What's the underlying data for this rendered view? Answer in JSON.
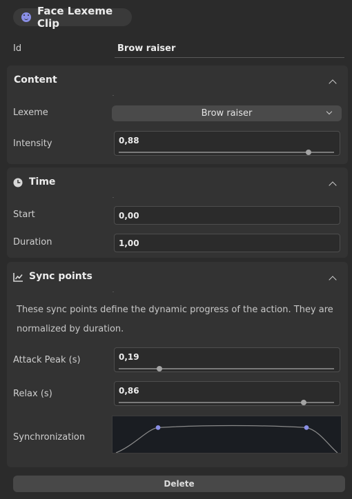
{
  "header": {
    "title": "Face Lexeme Clip",
    "icon": "smile-icon",
    "icon_color": "#8a8fe6"
  },
  "id_field": {
    "label": "Id",
    "value": "Brow raiser"
  },
  "content": {
    "title": "Content",
    "lexeme_label": "Lexeme",
    "lexeme_value": "Brow raiser",
    "intensity_label": "Intensity",
    "intensity_value": "0,88",
    "intensity_fraction": 0.88
  },
  "time": {
    "title": "Time",
    "start_label": "Start",
    "start_value": "0,00",
    "duration_label": "Duration",
    "duration_value": "1,00"
  },
  "sync": {
    "title": "Sync points",
    "description": "These sync points define the dynamic progress of the action. They are normalized by duration.",
    "attack_label": "Attack Peak (s)",
    "attack_value": "0,19",
    "attack_fraction": 0.19,
    "relax_label": "Relax (s)",
    "relax_value": "0,86",
    "relax_fraction": 0.86,
    "sync_label": "Synchronization"
  },
  "footer": {
    "delete_label": "Delete"
  }
}
